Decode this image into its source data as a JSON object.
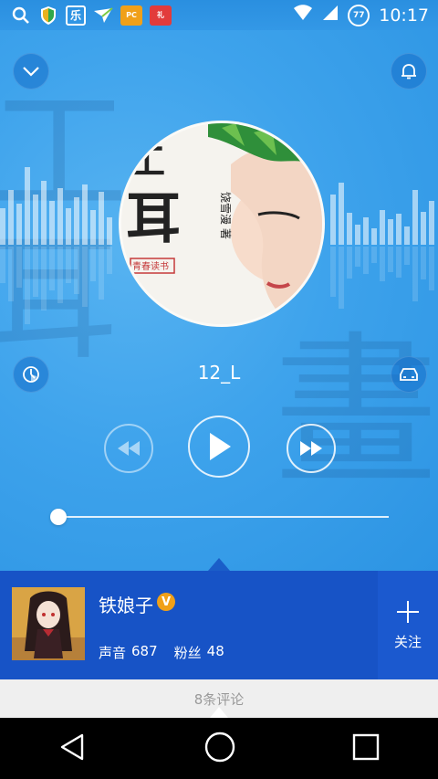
{
  "status_bar": {
    "time": "10:17",
    "battery": "77",
    "notification_icons": [
      "search-icon",
      "shield-icon",
      "le-app-icon",
      "send-icon",
      "pconline-app-icon",
      "gift-app-icon"
    ]
  },
  "player": {
    "track_title": "12_L",
    "progress": 0.0
  },
  "uploader": {
    "name": "铁娘子",
    "badge": "V",
    "sounds_label": "声音",
    "sounds_count": "687",
    "fans_label": "粉丝",
    "fans_count": "48",
    "follow_label": "关注"
  },
  "comments": {
    "label": "8条评论"
  },
  "colors": {
    "accent_blue": "#1753c6",
    "badge_orange": "#f0a019",
    "player_bg": "#3aa0ea"
  }
}
